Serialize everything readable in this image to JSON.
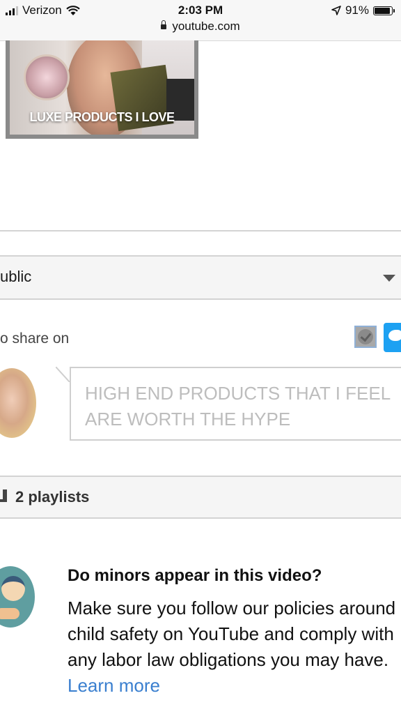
{
  "status_bar": {
    "carrier": "Verizon",
    "time": "2:03 PM",
    "url": "youtube.com",
    "battery": "91%",
    "battery_level": 0.91
  },
  "video": {
    "thumbnail_title": "LUXE PRODUCTS I LOVE"
  },
  "privacy": {
    "selected": "ublic"
  },
  "share": {
    "label": "o share on"
  },
  "description": {
    "placeholder": "HIGH END PRODUCTS THAT I FEEL ARE WORTH THE HYPE"
  },
  "playlists": {
    "label": "2 playlists"
  },
  "minors": {
    "title": "Do minors appear in this video?",
    "body": "Make sure you follow our policies around child safety on YouTube and comply with any labor law obligations you may have.",
    "link": "Learn more"
  },
  "colors": {
    "link": "#3a7fcf",
    "twitter": "#1da1f2",
    "divider": "#d3d3d3"
  },
  "icons": [
    "signal-icon",
    "wifi-icon",
    "lock-icon",
    "location-arrow-icon",
    "battery-icon",
    "dropdown-caret-icon",
    "checkbox-icon",
    "twitter-icon",
    "playlist-icon",
    "child-safety-icon"
  ]
}
